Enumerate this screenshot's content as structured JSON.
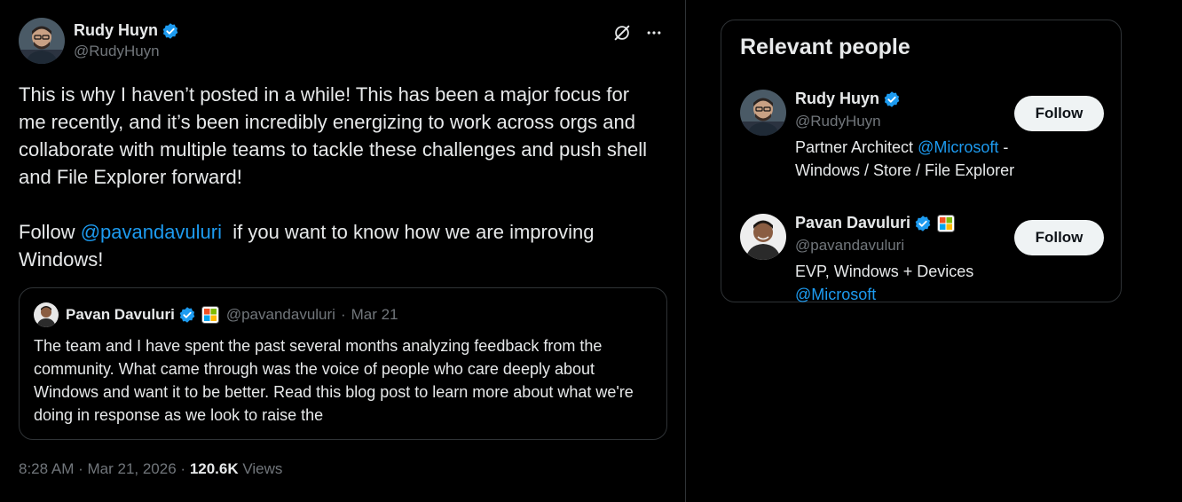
{
  "tweet": {
    "author_name": "Rudy Huyn",
    "author_handle": "@RudyHuyn",
    "text_part1": "This is why I haven’t posted in a while! This has been a major focus for me recently, and it’s been incredibly energizing to work across orgs and collaborate with multiple teams to tackle these challenges and push shell and File Explorer forward!\n\nFollow ",
    "mention": "@pavandavuluri",
    "text_part2": "  if you want to know how we are improving Windows!",
    "time": "8:28 AM",
    "date": "Mar 21, 2026",
    "views_count": "120.6K",
    "views_label": "Views",
    "icons": {
      "grok": "grok-icon",
      "more": "more-icon",
      "verified": "verified-badge-icon"
    }
  },
  "quote": {
    "author_name": "Pavan Davuluri",
    "author_handle": "@pavandavuluri",
    "date": "Mar 21",
    "text": "The team and I have spent the past several months analyzing feedback from the community. What came through was the voice of people who care deeply about Windows and want it to be better. Read this blog post to learn more about what we're doing in response as we look to raise the"
  },
  "sidebar": {
    "title": "Relevant people",
    "people": [
      {
        "name": "Rudy Huyn",
        "handle": "@RudyHuyn",
        "bio_prefix": "Partner Architect ",
        "bio_link": "@Microsoft",
        "bio_suffix": " - Windows / Store / File Explorer",
        "follow_label": "Follow"
      },
      {
        "name": "Pavan Davuluri",
        "handle": "@pavandavuluri",
        "bio_prefix": "EVP, Windows + Devices ",
        "bio_link": "@Microsoft",
        "bio_suffix": "",
        "follow_label": "Follow"
      }
    ]
  },
  "colors": {
    "background": "#000000",
    "text": "#e7e9ea",
    "muted": "#71767b",
    "link": "#1d9bf0",
    "border": "#2f3336",
    "verified": "#1d9bf0",
    "follow_bg": "#eff3f4"
  }
}
